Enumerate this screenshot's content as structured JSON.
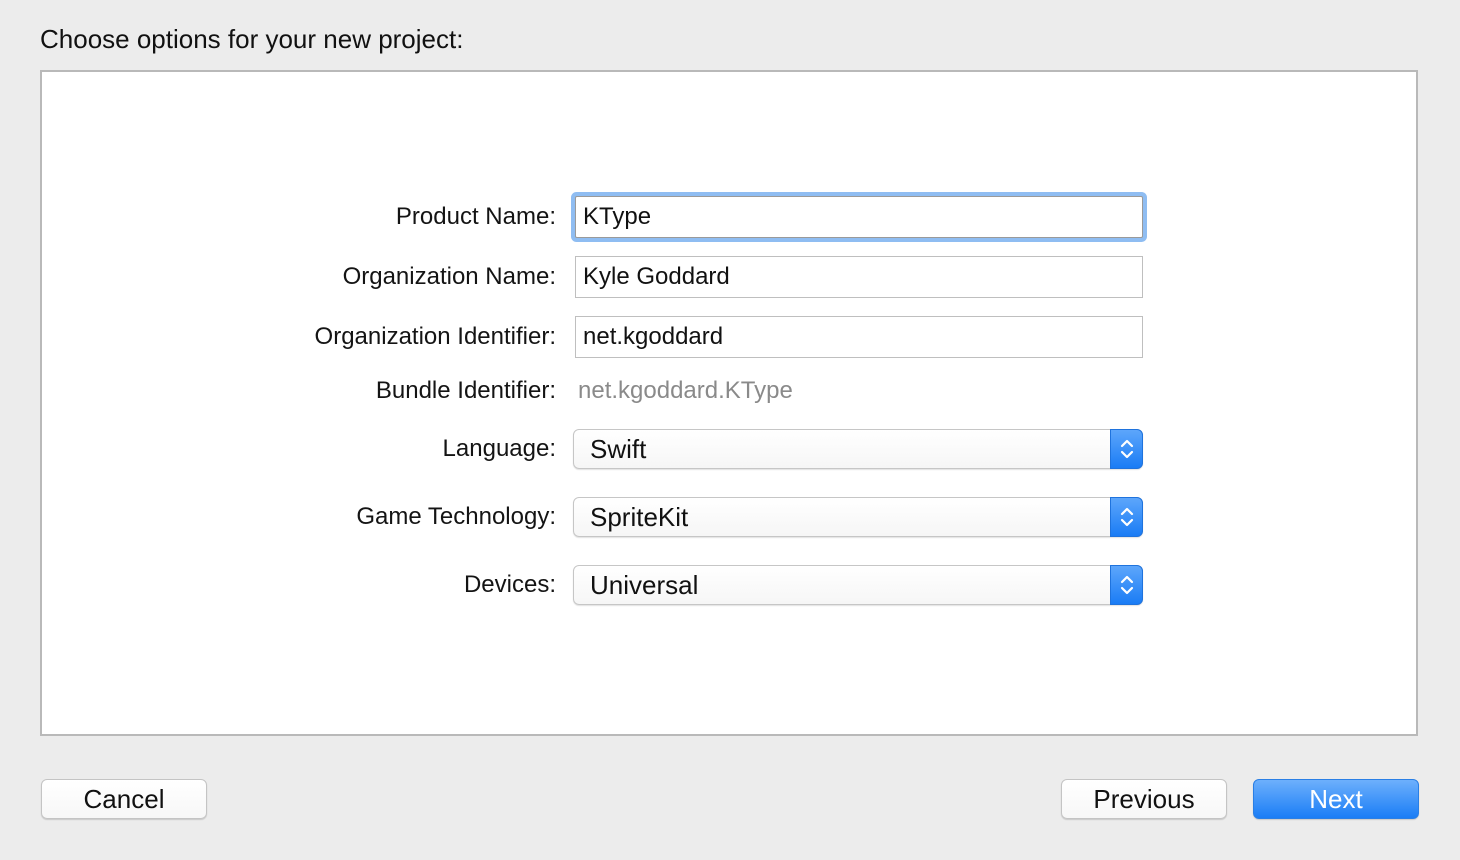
{
  "dialog": {
    "heading": "Choose options for your new project:"
  },
  "form": {
    "product_name": {
      "label": "Product Name:",
      "value": "KType"
    },
    "organization_name": {
      "label": "Organization Name:",
      "value": "Kyle Goddard"
    },
    "organization_identifier": {
      "label": "Organization Identifier:",
      "value": "net.kgoddard"
    },
    "bundle_identifier": {
      "label": "Bundle Identifier:",
      "value": "net.kgoddard.KType"
    },
    "language": {
      "label": "Language:",
      "selected": "Swift"
    },
    "game_technology": {
      "label": "Game Technology:",
      "selected": "SpriteKit"
    },
    "devices": {
      "label": "Devices:",
      "selected": "Universal"
    }
  },
  "buttons": {
    "cancel": "Cancel",
    "previous": "Previous",
    "next": "Next"
  },
  "colors": {
    "accent": "#1a7df6",
    "focus_ring": "#8fbdf2",
    "background": "#ececec",
    "panel": "#ffffff",
    "muted_text": "#8a8a8a"
  },
  "icons": {
    "popup_arrows": "up-down-chevron-icon"
  }
}
